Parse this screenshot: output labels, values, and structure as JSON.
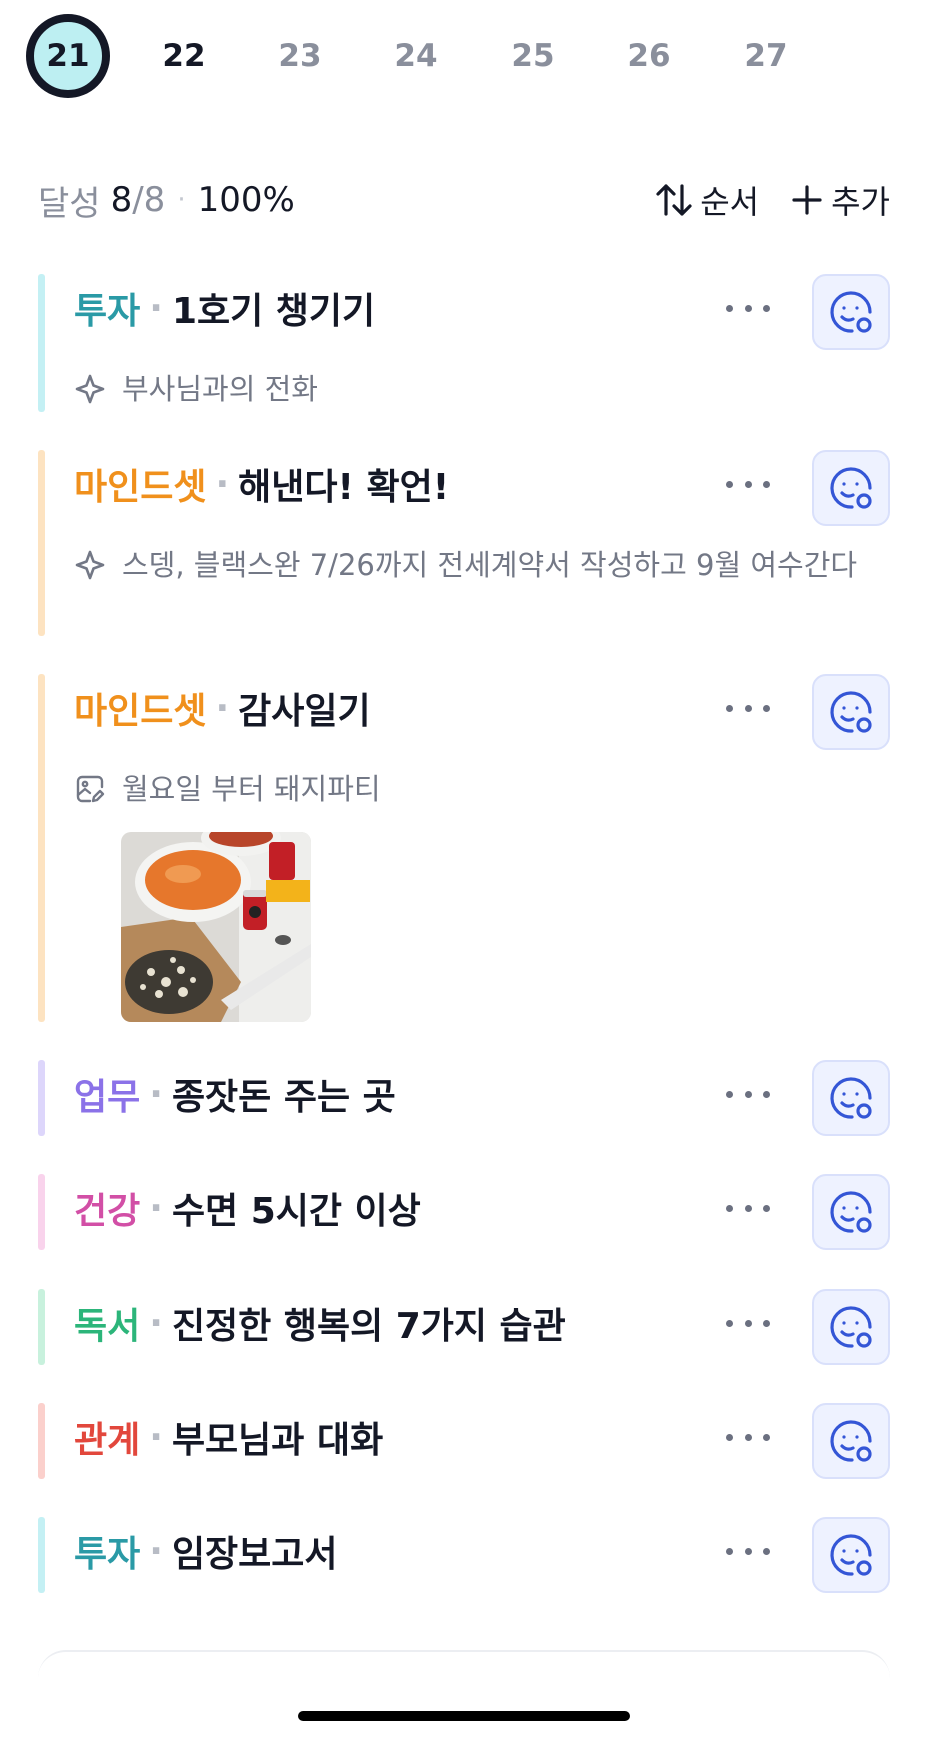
{
  "dates": [
    {
      "day": "21",
      "state": "selected"
    },
    {
      "day": "22",
      "state": "next"
    },
    {
      "day": "23",
      "state": "future"
    },
    {
      "day": "24",
      "state": "future"
    },
    {
      "day": "25",
      "state": "future"
    },
    {
      "day": "26",
      "state": "future"
    },
    {
      "day": "27",
      "state": "future"
    }
  ],
  "summary": {
    "label": "달성",
    "done": "8",
    "sep": "/",
    "total": "8",
    "dot": "·",
    "percent": "100%"
  },
  "actions": {
    "sort_label": "순서",
    "add_label": "추가"
  },
  "items": [
    {
      "category": "투자",
      "color": "#2a9aa6",
      "bar": "#c4f0f4",
      "sep": "·",
      "title": "1호기 챙기기",
      "note_icon": "sparkle-icon",
      "note": "부사님과의 전화"
    },
    {
      "category": "마인드셋",
      "color": "#f0901c",
      "bar": "#fde3c1",
      "sep": "·",
      "title": "해낸다! 확언!",
      "note_icon": "sparkle-icon",
      "note": "스뎅, 블랙스완 7/26까지 전세계약서 작성하고 9월 여수간다"
    },
    {
      "category": "마인드셋",
      "color": "#f0901c",
      "bar": "#fde3c1",
      "sep": "·",
      "title": "감사일기",
      "note_icon": "image-edit-icon",
      "note": "월요일 부터 돼지파티",
      "photo": "food-photo"
    },
    {
      "category": "업무",
      "color": "#8b72e8",
      "bar": "#ddd6fb",
      "sep": "·",
      "title": "종잣돈 주는 곳"
    },
    {
      "category": "건강",
      "color": "#d24fa6",
      "bar": "#f9d3ec",
      "sep": "·",
      "title": "수면 5시간 이상"
    },
    {
      "category": "독서",
      "color": "#2cb57a",
      "bar": "#c8f1dd",
      "sep": "·",
      "title": "진정한 행복의 7가지 습관"
    },
    {
      "category": "관계",
      "color": "#e2473c",
      "bar": "#fbd0cc",
      "sep": "·",
      "title": "부모님과 대화"
    },
    {
      "category": "투자",
      "color": "#2a9aa6",
      "bar": "#c4f0f4",
      "sep": "·",
      "title": "임장보고서"
    }
  ],
  "icons": {
    "more": "more-horizontal-icon",
    "mood": "smiley-add-icon",
    "sort": "sort-arrows-icon",
    "add": "plus-icon"
  }
}
